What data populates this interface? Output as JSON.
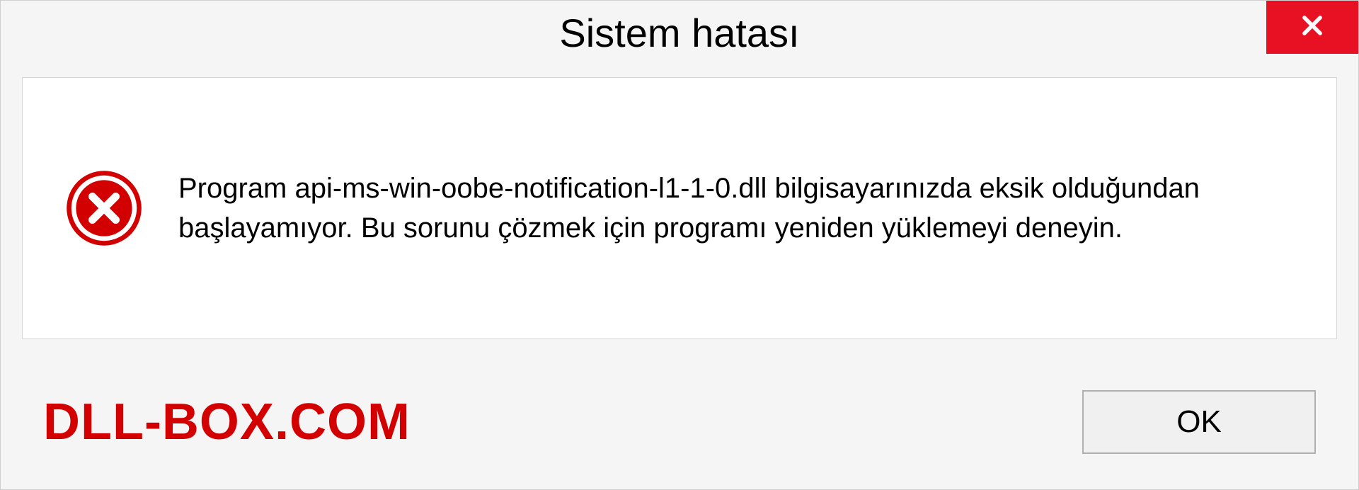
{
  "dialog": {
    "title": "Sistem hatası",
    "message": "Program api-ms-win-oobe-notification-l1-1-0.dll bilgisayarınızda eksik olduğundan başlayamıyor. Bu sorunu çözmek için programı yeniden yüklemeyi deneyin.",
    "ok_label": "OK"
  },
  "brand": {
    "text": "DLL-BOX.COM"
  }
}
